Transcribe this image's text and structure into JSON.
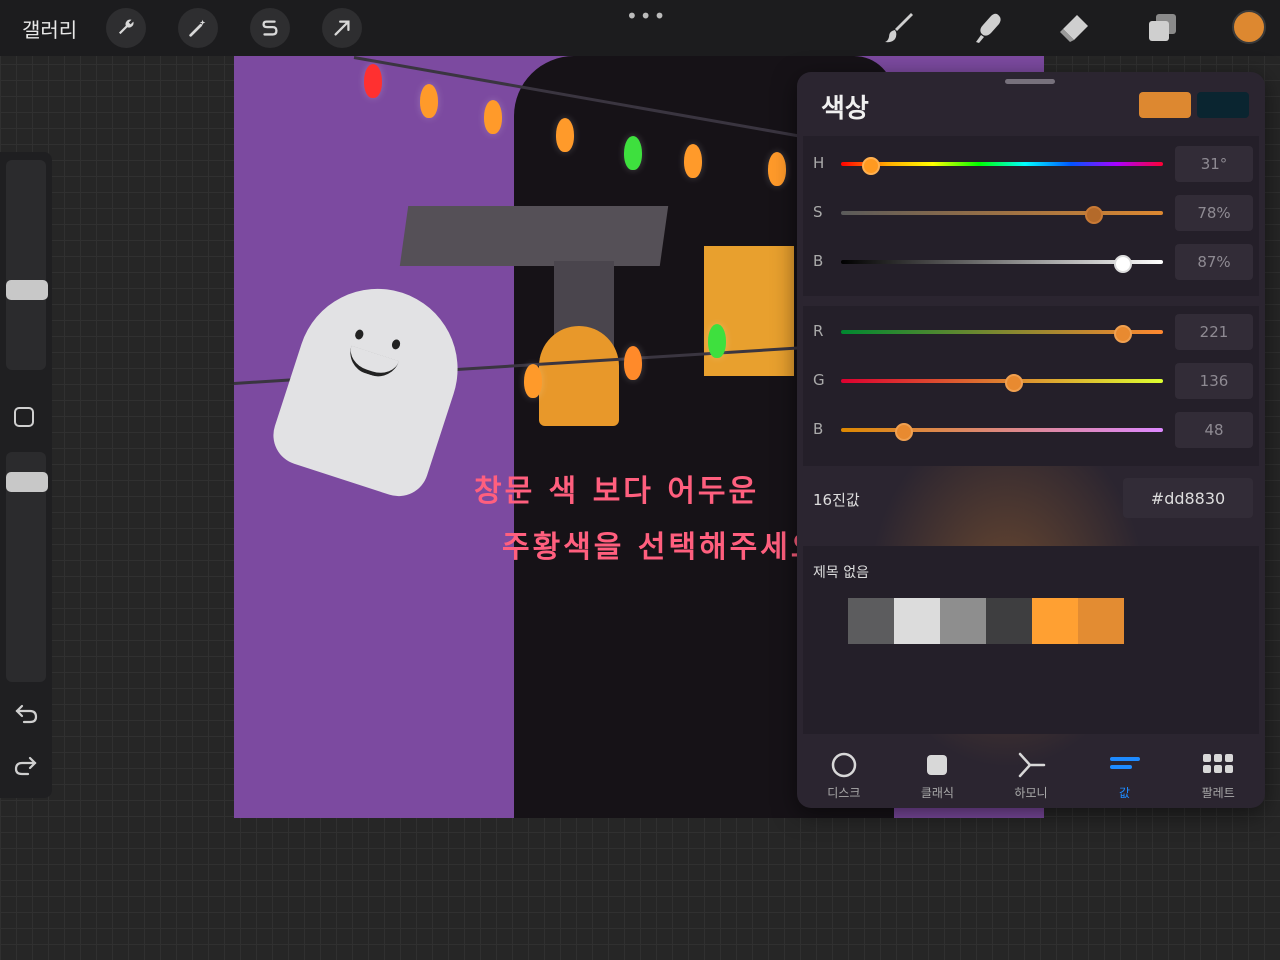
{
  "topbar": {
    "gallery_label": "갤러리",
    "more_label": "•••",
    "current_color": "#dd8830"
  },
  "canvas": {
    "background_color": "#7c4aa0",
    "annotation_line1": "창문 색 보다 어두운",
    "annotation_line2": "주황색을 선택해주세요!"
  },
  "color_panel": {
    "title": "색상",
    "current_color": "#dd8830",
    "previous_color": "#0a2530",
    "hsb": [
      {
        "label": "H",
        "value": "31°",
        "fraction": 0.086
      },
      {
        "label": "S",
        "value": "78%",
        "fraction": 0.78
      },
      {
        "label": "B",
        "value": "87%",
        "fraction": 0.87
      }
    ],
    "rgb": [
      {
        "label": "R",
        "value": "221",
        "fraction": 0.87
      },
      {
        "label": "G",
        "value": "136",
        "fraction": 0.53
      },
      {
        "label": "B",
        "value": "48",
        "fraction": 0.19
      }
    ],
    "hex_label": "16진값",
    "hex_value": "#dd8830",
    "palette": {
      "name": "제목 없음",
      "swatches": [
        "#5c5c5e",
        "#dcdcdc",
        "#8e8e8e",
        "#3e3e40",
        "#ffa032",
        "#e38c32"
      ]
    },
    "tabs": [
      {
        "label": "디스크",
        "icon": "disc-icon"
      },
      {
        "label": "클래식",
        "icon": "classic-square-icon"
      },
      {
        "label": "하모니",
        "icon": "harmony-icon"
      },
      {
        "label": "값",
        "icon": "value-sliders-icon",
        "active": true
      },
      {
        "label": "팔레트",
        "icon": "palette-grid-icon"
      }
    ]
  }
}
